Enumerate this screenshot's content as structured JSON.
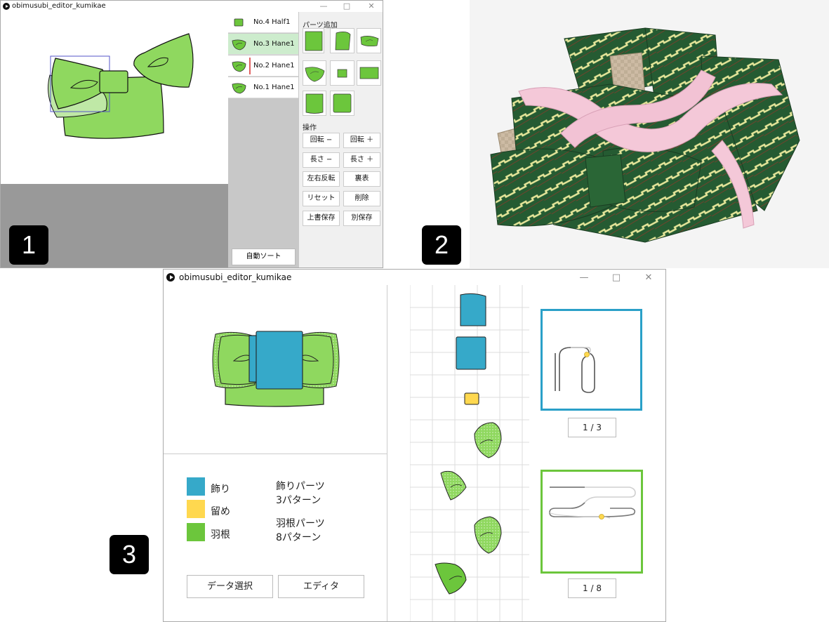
{
  "badges": {
    "one": "1",
    "two": "2",
    "three": "3"
  },
  "window1": {
    "title": "obimusubi_editor_kumikae",
    "controls": {
      "minimize": "—",
      "maximize": "□",
      "close": "✕"
    },
    "parts_list": [
      {
        "label": "No.4 Half1",
        "selected": false
      },
      {
        "label": "No.3 Hane1",
        "selected": true
      },
      {
        "label": "No.2 Hane1",
        "selected": false
      },
      {
        "label": "No.1 Hane1",
        "selected": false
      }
    ],
    "add_parts_title": "パーツ追加",
    "operations_title": "操作",
    "operation_buttons": [
      "回転 −",
      "回転 ＋",
      "長さ −",
      "長さ ＋",
      "左右反転",
      "裏表",
      "リセット",
      "削除",
      "上書保存",
      "別保存"
    ],
    "auto_sort_label": "自動ソート",
    "colors": {
      "part_green": "#8fd85f",
      "selected_row": "#cdeccd",
      "panel_gray": "#c8c8c8"
    }
  },
  "window3": {
    "title": "obimusubi_editor_kumikae",
    "controls": {
      "minimize": "—",
      "maximize": "□",
      "close": "✕"
    },
    "legend": [
      {
        "label": "飾り",
        "color": "#36a9c9"
      },
      {
        "label": "留め",
        "color": "#ffd84f"
      },
      {
        "label": "羽根",
        "color": "#6cc63c"
      }
    ],
    "pattern_info": {
      "decor_line1": "飾りパーツ",
      "decor_line2": "3パターン",
      "wing_line1": "羽根パーツ",
      "wing_line2": "8パターン"
    },
    "data_select_label": "データ選択",
    "editor_label": "エディタ",
    "decor_page": "1 / 3",
    "wing_page": "1 / 8",
    "colors": {
      "decor": "#36a9c9",
      "clip": "#ffd84f",
      "wing": "#6cc63c",
      "decor_frame": "#2aa0c8",
      "wing_frame": "#6cc63c"
    }
  }
}
